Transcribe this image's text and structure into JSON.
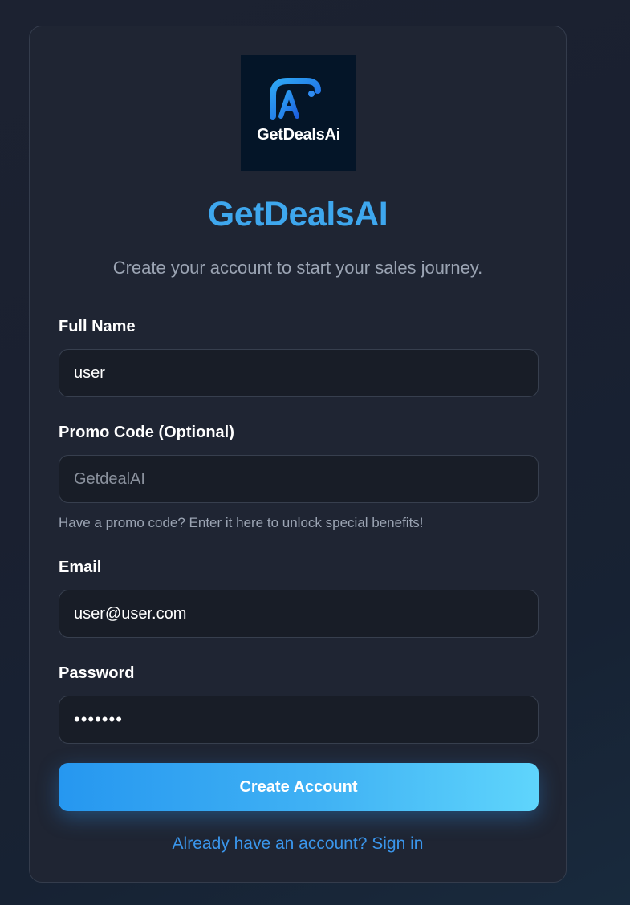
{
  "logo": {
    "text": "GetDealsAi",
    "icon": "ai-logo-icon",
    "bg_color": "#041528"
  },
  "header": {
    "title": "GetDealsAI",
    "subtitle": "Create your account to start your sales journey."
  },
  "form": {
    "full_name": {
      "label": "Full Name",
      "value": "user"
    },
    "promo_code": {
      "label": "Promo Code (Optional)",
      "value": "",
      "placeholder": "GetdealAI",
      "hint": "Have a promo code? Enter it here to unlock special benefits!"
    },
    "email": {
      "label": "Email",
      "value": "user@user.com"
    },
    "password": {
      "label": "Password",
      "value": "•••••••"
    },
    "submit_label": "Create Account"
  },
  "footer": {
    "signin_text": "Already have an account? Sign in"
  },
  "colors": {
    "accent": "#3ea7ee",
    "button_gradient_start": "#2697f0",
    "button_gradient_end": "#5fd5fc",
    "link": "#3a96ec",
    "card_bg": "#1f2533",
    "input_bg": "#181d27"
  }
}
